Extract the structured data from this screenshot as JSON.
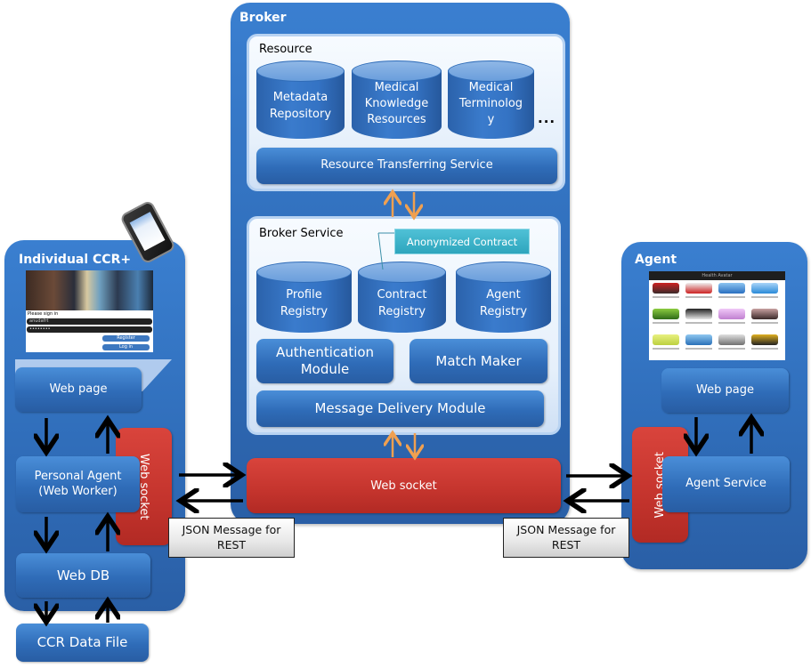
{
  "broker": {
    "title": "Broker",
    "resource": {
      "title": "Resource",
      "stores": [
        "Metadata Repository",
        "Medical Knowledge Resources",
        "Medical Terminology"
      ],
      "stores_lines": [
        [
          "Metadata",
          "Repository"
        ],
        [
          "Medical",
          "Knowledge",
          "Resources"
        ],
        [
          "Medical",
          "Terminolog",
          "y"
        ]
      ],
      "ellipsis": "...",
      "service": "Resource Transferring Service"
    },
    "broker_service": {
      "title": "Broker Service",
      "callout": "Anonymized Contract",
      "registries": [
        [
          "Profile",
          "Registry"
        ],
        [
          "Contract",
          "Registry"
        ],
        [
          "Agent",
          "Registry"
        ]
      ],
      "auth_module": [
        "Authentication",
        "Module"
      ],
      "match_maker": "Match Maker",
      "message_delivery": "Message Delivery Module"
    },
    "web_socket": "Web socket"
  },
  "individual": {
    "title": "Individual CCR+",
    "login_mock": {
      "prompt": "Please sign in",
      "username": "anudafrt",
      "password": "••••••••",
      "register": "Register",
      "login": "Log in"
    },
    "web_page": "Web page",
    "personal_agent": [
      "Personal Agent",
      "(Web Worker)"
    ],
    "web_socket": "Web socket",
    "web_db": "Web DB",
    "ccr_file": "CCR Data File"
  },
  "agent": {
    "title": "Agent",
    "app_mock_title": "Health Avatar",
    "web_page": "Web page",
    "web_socket": "Web socket",
    "agent_service": "Agent Service"
  },
  "json_labels": {
    "left": [
      "JSON Message for",
      "REST"
    ],
    "right": [
      "JSON Message for",
      "REST"
    ]
  },
  "colors": {
    "panel_blue": "#2f6cb8",
    "module_blue": "#3a7bcc",
    "socket_red": "#c4342d",
    "arrow_orange": "#f0a050",
    "callout_teal": "#2ea5bd"
  }
}
